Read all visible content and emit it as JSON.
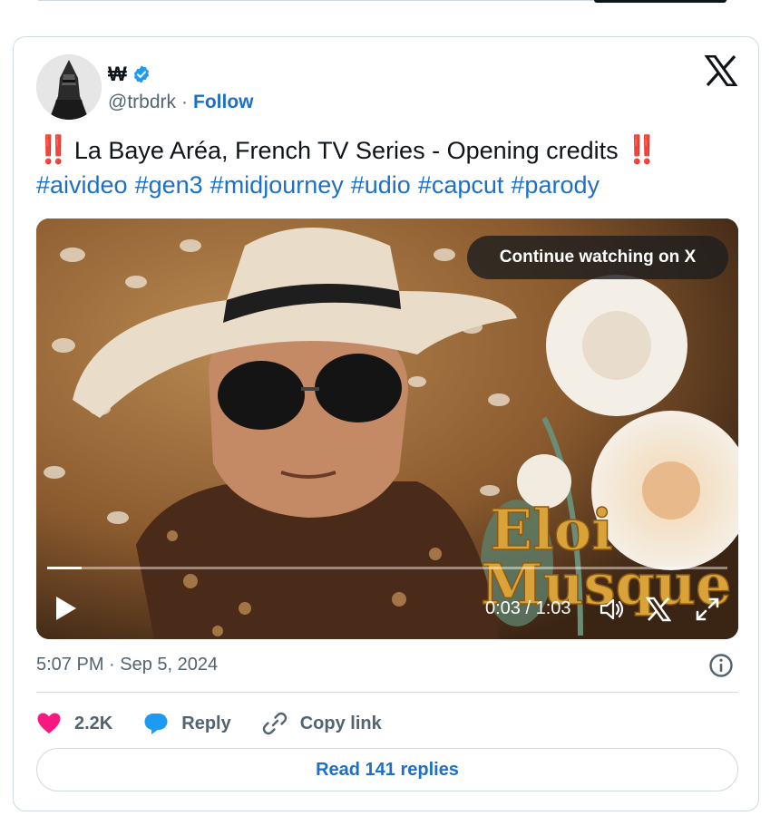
{
  "author": {
    "display_name": "₩",
    "handle": "@trbdrk",
    "separator": "·",
    "follow_label": "Follow",
    "verified_color": "#1d9bf0"
  },
  "tweet": {
    "bang_left": "‼️",
    "text": "La Baye Aréa, French TV Series - Opening credits",
    "bang_right": "‼️",
    "hashtags": [
      "#aivideo",
      "#gen3",
      "#midjourney",
      "#udio",
      "#capcut",
      "#parody"
    ]
  },
  "video": {
    "continue_label": "Continue watching on X",
    "time_display": "0:03 / 1:03",
    "progress_fraction": 0.05,
    "overlay_title_line1": "Eloi",
    "overlay_title_line2": "Musque"
  },
  "meta": {
    "timestamp": "5:07 PM · Sep 5, 2024"
  },
  "actions": {
    "likes": "2.2K",
    "reply_label": "Reply",
    "copy_label": "Copy link"
  },
  "footer": {
    "read_replies_label": "Read 141 replies"
  },
  "colors": {
    "link": "#1d70c4",
    "heart": "#f91880",
    "reply_bubble": "#1d9bf0",
    "muted": "#536471",
    "border": "#cfd9de"
  },
  "icons": [
    "x-logo-icon",
    "verified-badge-icon",
    "play-icon",
    "volume-icon",
    "x-watermark-icon",
    "fullscreen-icon",
    "info-icon",
    "heart-icon",
    "reply-icon",
    "link-icon"
  ]
}
